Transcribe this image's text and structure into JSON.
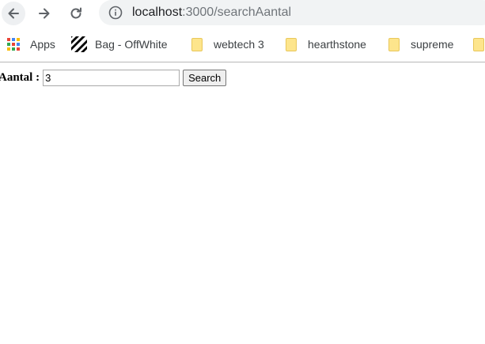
{
  "browser": {
    "url_host": "localhost",
    "url_path": ":3000/searchAantal"
  },
  "bookmarks": [
    {
      "label": "Apps",
      "icon": "apps-grid-icon"
    },
    {
      "label": "Bag - OffWhite",
      "icon": "offwhite-stripes-icon"
    },
    {
      "label": "webtech 3",
      "icon": "folder-icon"
    },
    {
      "label": "hearthstone",
      "icon": "folder-icon"
    },
    {
      "label": "supreme",
      "icon": "folder-icon"
    }
  ],
  "form": {
    "label": "Aantal :",
    "input_value": "3",
    "button_label": "Search"
  }
}
